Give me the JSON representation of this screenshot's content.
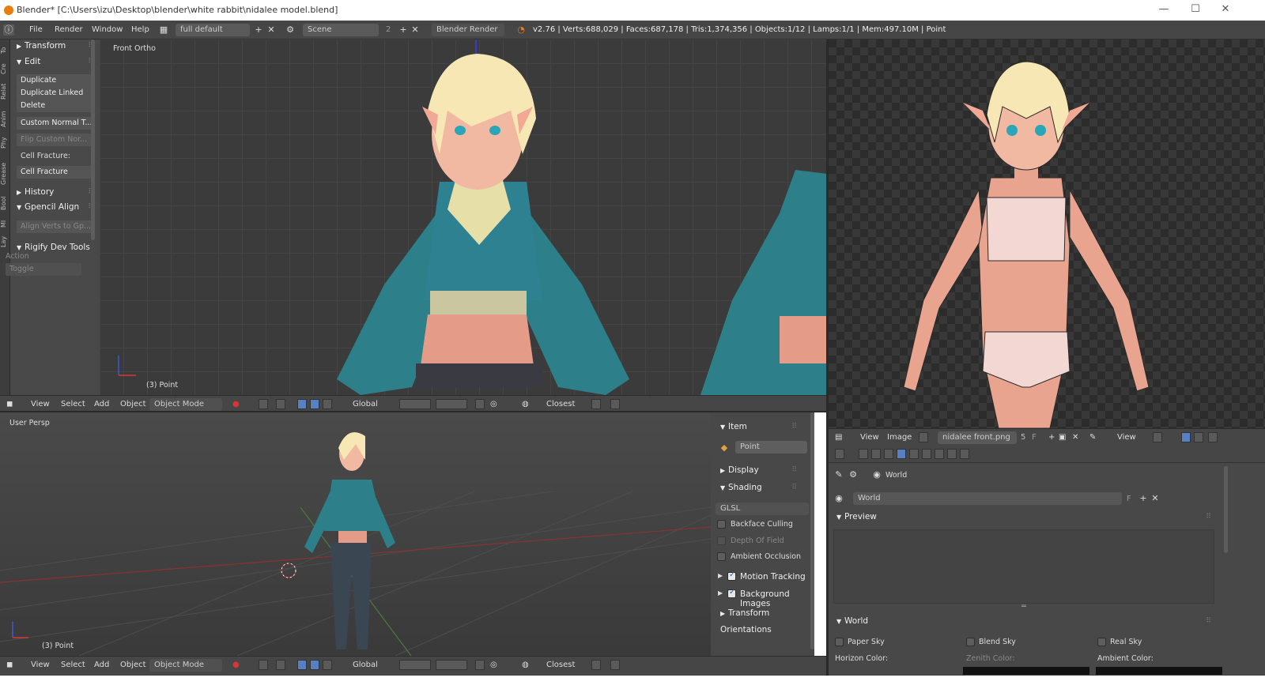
{
  "window": {
    "title": "Blender* [C:\\Users\\izu\\Desktop\\blender\\white rabbit\\nidalee model.blend]"
  },
  "info": {
    "menus": [
      "File",
      "Render",
      "Window",
      "Help"
    ],
    "screen_layout": "full default",
    "scene": "Scene",
    "scene_users": "2",
    "render_engine": "Blender Render",
    "stats": "v2.76 | Verts:688,029 | Faces:687,178 | Tris:1,374,356 | Objects:1/12 | Lamps:1/1 | Mem:497.10M | Point"
  },
  "toolshelf": {
    "tabs": [
      "To",
      "Cre",
      "Relat",
      "Anim",
      "Phy",
      "Grease",
      "Bool",
      "MI",
      "Lay"
    ],
    "transform_header": "Transform",
    "edit_header": "Edit",
    "edit_buttons": [
      "Duplicate",
      "Duplicate Linked",
      "Delete",
      "Custom Normal T...",
      "Flip Custom Nor..."
    ],
    "cell_fracture_label": "Cell Fracture:",
    "cell_fracture_button": "Cell Fracture",
    "history_header": "History",
    "gpencil_header": "Gpencil Align",
    "gpencil_button": "Align Verts to Gp...",
    "rigify_header": "Rigify Dev Tools",
    "action_label": "Action",
    "toggle_button": "Toggle"
  },
  "viewport_top": {
    "label": "Front Ortho",
    "object_label": "(3) Point"
  },
  "viewport_bottom": {
    "label": "User Persp",
    "object_label": "(3) Point"
  },
  "header3d": {
    "menus": [
      "View",
      "Select",
      "Add",
      "Object"
    ],
    "mode": "Object Mode",
    "orientation": "Global",
    "snap": "Closest"
  },
  "npanel": {
    "item_header": "Item",
    "item_name": "Point",
    "display_header": "Display",
    "shading_header": "Shading",
    "shading_mode": "GLSL",
    "options": [
      {
        "label": "Backface Culling",
        "checked": false,
        "enabled": true
      },
      {
        "label": "Depth Of Field",
        "checked": false,
        "enabled": false
      },
      {
        "label": "Ambient Occlusion",
        "checked": false,
        "enabled": true
      }
    ],
    "motion_tracking": "Motion Tracking",
    "background_images": "Background Images",
    "transform_orientations": "Transform Orientations"
  },
  "image_editor": {
    "menus": [
      "View",
      "Image"
    ],
    "image_name": "nidalee front.png",
    "image_users": "5",
    "fake_user": "F",
    "view_label": "View"
  },
  "properties": {
    "breadcrumb": "World",
    "world_name": "World",
    "fake_user": "F",
    "preview_header": "Preview",
    "world_header": "World",
    "sky_options": [
      "Paper Sky",
      "Blend Sky",
      "Real Sky"
    ],
    "color_labels": [
      "Horizon Color:",
      "Zenith Color:",
      "Ambient Color:"
    ]
  },
  "colors": {
    "accent": "#5680c2",
    "background": "#3b3b3b",
    "header": "#464646",
    "panel": "#494949"
  }
}
